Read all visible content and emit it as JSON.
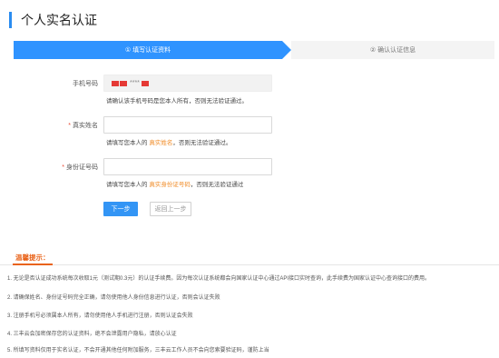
{
  "header": {
    "title": "个人实名认证"
  },
  "steps": {
    "active": "① 填写认证资料",
    "inactive": "② 确认认证信息"
  },
  "form": {
    "phone": {
      "label": "手机号码",
      "value_suffix": "****",
      "hint": "请确认该手机号码是您本人所有，否则无法验证通过。"
    },
    "name": {
      "required_mark": "*",
      "label": "真实姓名",
      "value": "",
      "hint_prefix": "请填写您本人的",
      "hint_emph": "真实姓名",
      "hint_suffix": "，否则无法验证通过。"
    },
    "idnum": {
      "required_mark": "*",
      "label": "身份证号码",
      "value": "",
      "hint_prefix": "请填写您本人的",
      "hint_emph": "真实身份证号码",
      "hint_suffix": "，否则无法验证通过"
    },
    "buttons": {
      "next": "下一步",
      "back": "返回上一步"
    }
  },
  "tips": {
    "title": "温馨提示：",
    "items": [
      "1. 无论是否认证成功系统每次收取1元（测试期0.3元）的认证手续费。因为每次认证系统都会向国家认证中心通过API接口实时查询，此手续费为国家认证中心查询接口的费用。",
      "2. 请确保姓名、身份证号码完全正确，请勿使用他人身份信息进行认证，否则会认证失败",
      "3. 注册手机号必须属本人所有，请勿使用他人手机进行注册，否则认证会失败",
      "4. 三丰云会加密保存您的认证资料，绝不会泄露用户隐私，请放心认证",
      "5. 所填写资料仅用于实名认证，不会开通其他任何附加服务，三丰云工作人员不会向您索要验证码，谨防上当"
    ]
  },
  "colors": {
    "accent": "#2f93ff",
    "warning": "#e9631a",
    "mask": "#e53935"
  }
}
